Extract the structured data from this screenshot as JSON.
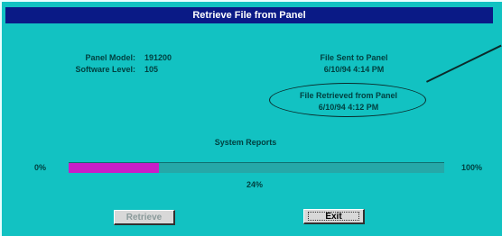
{
  "window": {
    "title": "Retrieve File from Panel"
  },
  "info": {
    "panel_model_label": "Panel Model:",
    "panel_model_value": "191200",
    "software_level_label": "Software Level:",
    "software_level_value": "105",
    "file_sent_label": "File Sent to Panel",
    "file_sent_value": "6/10/94 4:14 PM",
    "file_retrieved_label": "File Retrieved from Panel",
    "file_retrieved_value": "6/10/94 4:12 PM"
  },
  "progress": {
    "title": "System Reports",
    "min_label": "0%",
    "max_label": "100%",
    "percent_label": "24%",
    "value": 0.24,
    "fill_color": "#c81ec8",
    "track_color": "#25a8a8"
  },
  "buttons": {
    "retrieve_label": "Retrieve",
    "exit_label": "Exit"
  },
  "colors": {
    "dialog_bg": "#12c2c2",
    "titlebar_bg": "#0a1a86"
  }
}
